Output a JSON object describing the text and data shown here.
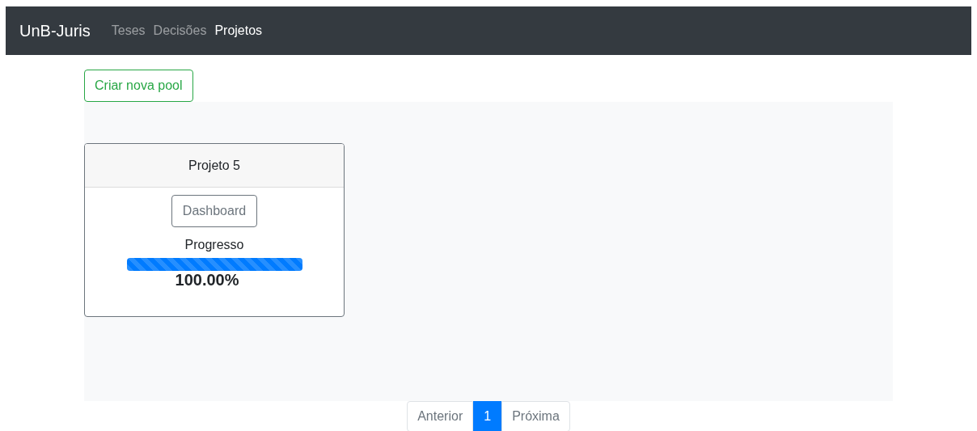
{
  "navbar": {
    "brand": "UnB-Juris",
    "links": [
      {
        "label": "Teses",
        "selected": false
      },
      {
        "label": "Decisões",
        "selected": false
      },
      {
        "label": "Projetos",
        "selected": true
      }
    ]
  },
  "create_button": "Criar nova pool",
  "projects": [
    {
      "title": "Projeto 5",
      "button": "Dashboard",
      "progress_label": "Progresso",
      "level": 1,
      "percentage": "100.00%"
    }
  ],
  "pagination": {
    "previous": "Anterior",
    "pages": [
      {
        "label": "1",
        "selected": true
      }
    ],
    "next": "Próxima"
  }
}
